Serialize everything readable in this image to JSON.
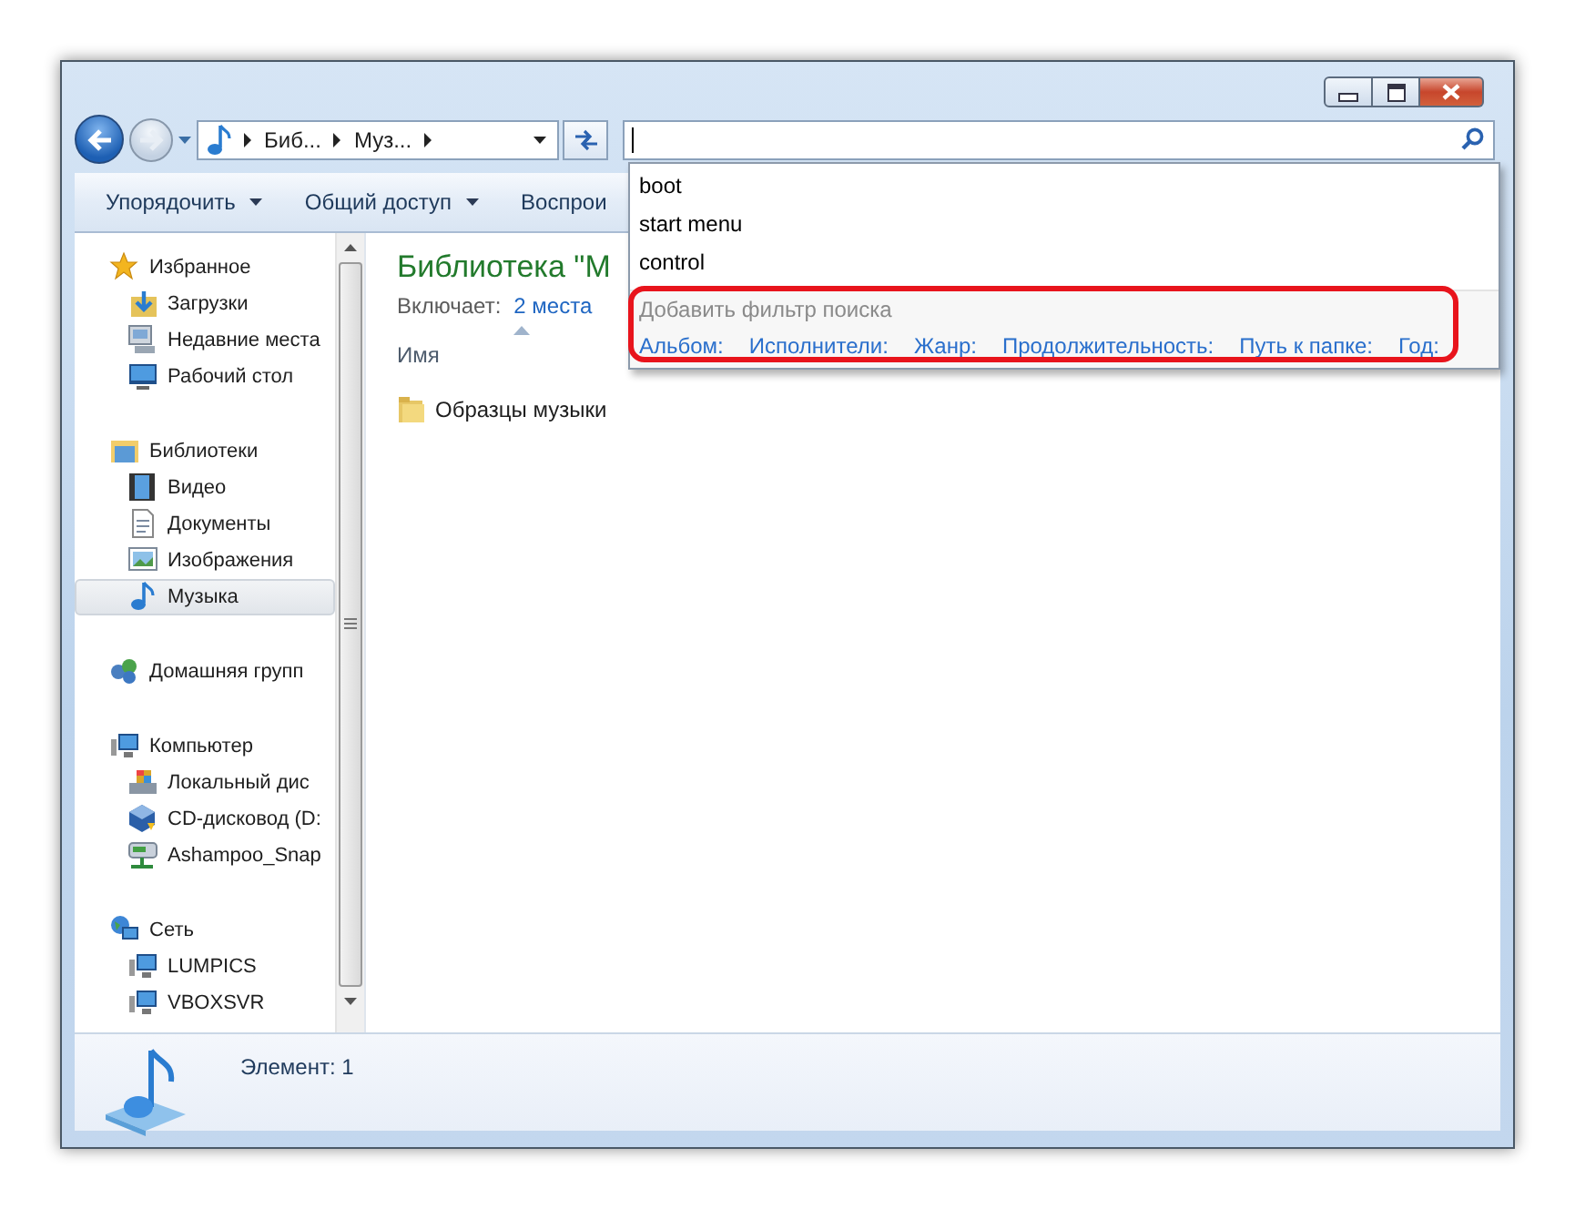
{
  "nav": [
    {
      "kind": "back",
      "disabled": false
    },
    {
      "kind": "forward",
      "disabled": true
    }
  ],
  "address": {
    "crumbs": [
      "Биб...",
      "Муз..."
    ]
  },
  "search": {
    "suggestions": [
      "boot",
      "start menu",
      "control"
    ],
    "filter_title": "Добавить фильтр поиска",
    "filters": [
      "Альбом:",
      "Исполнители:",
      "Жанр:",
      "Продолжительность:",
      "Путь к папке:",
      "Год:"
    ]
  },
  "toolbar": [
    {
      "label": "Упорядочить",
      "has_menu": true
    },
    {
      "label": "Общий доступ",
      "has_menu": true
    },
    {
      "label": "Воспрои",
      "has_menu": false
    }
  ],
  "sidebar": {
    "groups": [
      {
        "label": "Избранное",
        "selected": false,
        "children": [
          {
            "label": "Загрузки",
            "selected": false
          },
          {
            "label": "Недавние места",
            "selected": false
          },
          {
            "label": "Рабочий стол",
            "selected": false
          }
        ]
      },
      {
        "label": "Библиотеки",
        "selected": false,
        "children": [
          {
            "label": "Видео",
            "selected": false
          },
          {
            "label": "Документы",
            "selected": false
          },
          {
            "label": "Изображения",
            "selected": false
          },
          {
            "label": "Музыка",
            "selected": true
          }
        ]
      },
      {
        "label": "Домашняя групп",
        "selected": false
      },
      {
        "label": "Компьютер",
        "selected": false,
        "children": [
          {
            "label": "Локальный дис",
            "selected": false
          },
          {
            "label": "CD-дисковод (D:",
            "selected": false
          },
          {
            "label": "Ashampoo_Snap",
            "selected": false
          }
        ]
      },
      {
        "label": "Сеть",
        "selected": false,
        "children": [
          {
            "label": "LUMPICS",
            "selected": false
          },
          {
            "label": "VBOXSVR",
            "selected": false
          }
        ]
      }
    ]
  },
  "content": {
    "title": "Библиотека \"М",
    "includes_label": "Включает:",
    "includes_link": "2 места",
    "column": "Имя",
    "items": [
      "Образцы музыки"
    ]
  },
  "status_bar": {
    "text": "Элемент: 1"
  }
}
